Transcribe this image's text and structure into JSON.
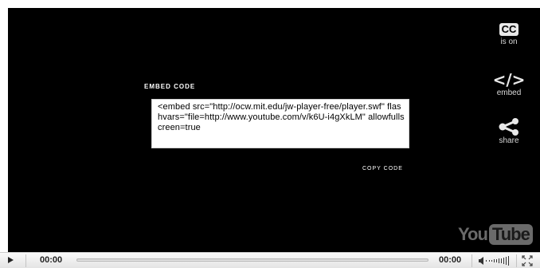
{
  "player": {
    "side_buttons": {
      "cc": {
        "icon_text": "CC",
        "label": "is on"
      },
      "embed": {
        "icon_text": "</>",
        "label": "embed"
      },
      "share": {
        "label": "share"
      }
    },
    "embed_panel": {
      "title": "EMBED CODE",
      "code": "<embed src=\"http://ocw.mit.edu/jw-player-free/player.swf\" flashvars=\"file=http://www.youtube.com/v/k6U-i4gXkLM\" allowfullscreen=true",
      "copy_label": "COPY CODE"
    },
    "logo": {
      "you": "You",
      "tube": "Tube"
    }
  },
  "controls": {
    "elapsed": "00:00",
    "total": "00:00",
    "progress_fraction": 0
  },
  "colors": {
    "player_background": "#000000",
    "control_bar": "#eeeeee",
    "accent_red": "#cc3300"
  },
  "icons": {
    "play": "play-icon",
    "volume": "volume-icon",
    "fullscreen": "fullscreen-icon",
    "share": "share-icon"
  }
}
